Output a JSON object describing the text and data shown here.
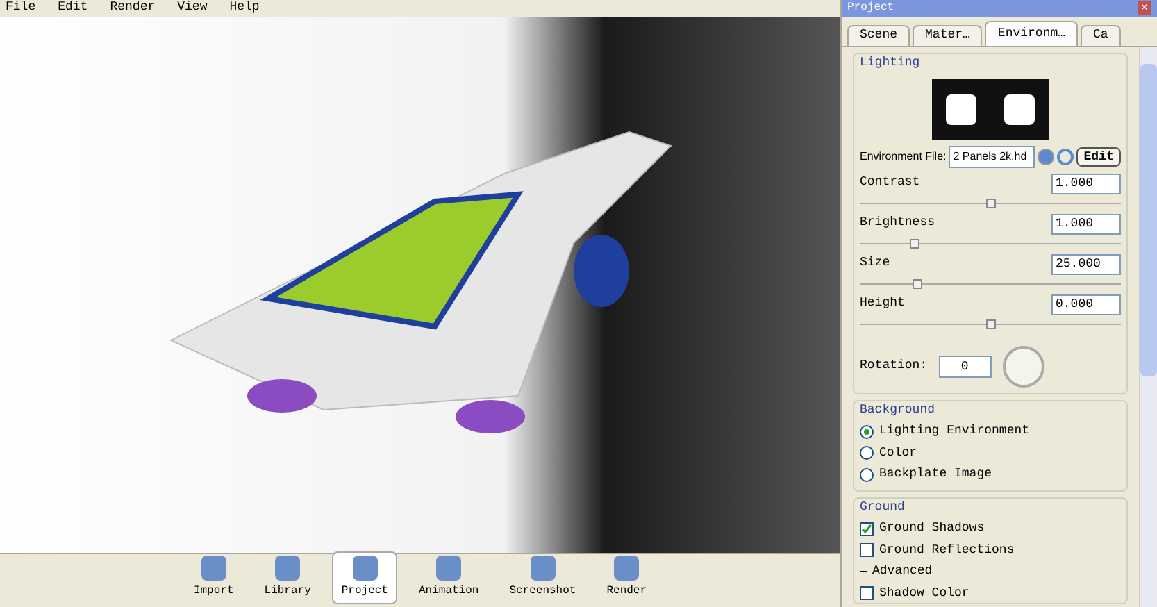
{
  "menu": [
    "File",
    "Edit",
    "Render",
    "View",
    "Help"
  ],
  "panel": {
    "title": "Project",
    "close": "×",
    "tabs": [
      {
        "label": "Scene",
        "selected": false
      },
      {
        "label": "Mater…",
        "selected": false
      },
      {
        "label": "Environm…",
        "selected": true
      },
      {
        "label": "Ca",
        "selected": false
      }
    ],
    "lighting": {
      "heading": "Lighting",
      "env_label": "Environment File:",
      "env_value": "2 Panels 2k.hd",
      "edit": "Edit",
      "sliders": [
        {
          "label": "Contrast",
          "value": "1.000",
          "level": 0.5
        },
        {
          "label": "Brightness",
          "value": "1.000",
          "level": 0.21
        },
        {
          "label": "Size",
          "value": "25.000",
          "level": 0.22
        },
        {
          "label": "Height",
          "value": "0.000",
          "level": 0.5
        }
      ],
      "rotation_label": "Rotation:",
      "rotation_value": "0"
    },
    "background": {
      "heading": "Background",
      "options": [
        {
          "label": "Lighting Environment",
          "selected": true
        },
        {
          "label": "Color",
          "selected": false
        },
        {
          "label": "Backplate Image",
          "selected": false
        }
      ]
    },
    "ground": {
      "heading": "Ground",
      "items": [
        {
          "kind": "checkbox",
          "label": "Ground Shadows",
          "checked": true
        },
        {
          "kind": "checkbox",
          "label": "Ground Reflections",
          "checked": false
        },
        {
          "kind": "section",
          "label": "Advanced"
        },
        {
          "kind": "checkbox",
          "label": "Shadow Color",
          "checked": false
        }
      ]
    }
  },
  "toolbar": [
    {
      "label": "Import",
      "selected": false
    },
    {
      "label": "Library",
      "selected": false
    },
    {
      "label": "Project",
      "selected": true
    },
    {
      "label": "Animation",
      "selected": false
    },
    {
      "label": "Screenshot",
      "selected": false
    },
    {
      "label": "Render",
      "selected": false
    }
  ]
}
